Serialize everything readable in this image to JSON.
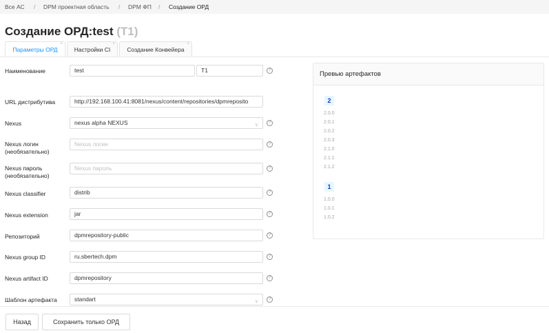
{
  "breadcrumb": [
    "Все АС",
    "DPM проектная область",
    "DPM ФП",
    "Создание ОРД"
  ],
  "breadcrumb_separator": "/",
  "title": {
    "main": "Создание ОРД:test",
    "code": "(T1)"
  },
  "tabs": [
    "Параметры ОРД",
    "Настройки CI",
    "Создание Конвейера"
  ],
  "tab_close_glyph": "×",
  "form": {
    "name_label": "Наименование",
    "name_value": "test",
    "code_value": "T1",
    "url_label": "URL дистрибутива",
    "url_value": "http://192.168.100.41:8081/nexus/content/repositories/dpmreposito",
    "nexus_label": "Nexus",
    "nexus_value": "nexus alpha NEXUS",
    "login_label_1": "Nexus логин",
    "login_label_2": "(необязательно)",
    "login_placeholder": "Nexus логин",
    "password_label_1": "Nexus пароль",
    "password_label_2": "(необязательно)",
    "password_placeholder": "Nexus пароль",
    "classifier_label": "Nexus classifier",
    "classifier_value": "distrib",
    "extension_label": "Nexus extension",
    "extension_value": "jar",
    "repo_label": "Репозиторий",
    "repo_value": "dpmrepository-public",
    "group_label": "Nexus group ID",
    "group_value": "ru.sbertech.dpm",
    "artifact_label": "Nexus artifact ID",
    "artifact_value": "dpmrepository",
    "template_label": "Шаблон артефакта",
    "template_value": "standart"
  },
  "help_glyph": "?",
  "chevron_glyph": "∨",
  "icons": {
    "help": "question-circle-icon",
    "select": "chevron-down-icon",
    "tab_close": "close-icon"
  },
  "preview": {
    "title": "Превью артефактов",
    "groups": [
      {
        "major": "2",
        "versions": [
          "2.0.0",
          "2.0.1",
          "2.0.2",
          "2.0.3",
          "2.1.0",
          "2.1.1",
          "2.1.2"
        ]
      },
      {
        "major": "1",
        "versions": [
          "1.0.0",
          "1.0.1",
          "1.0.2"
        ]
      }
    ]
  },
  "footer": {
    "back_label": "Назад",
    "save_label": "Сохранить только ОРД"
  },
  "colors": {
    "accent": "#1890ff",
    "badge_bg": "#e6f7ff",
    "border": "#d9d9d9"
  }
}
